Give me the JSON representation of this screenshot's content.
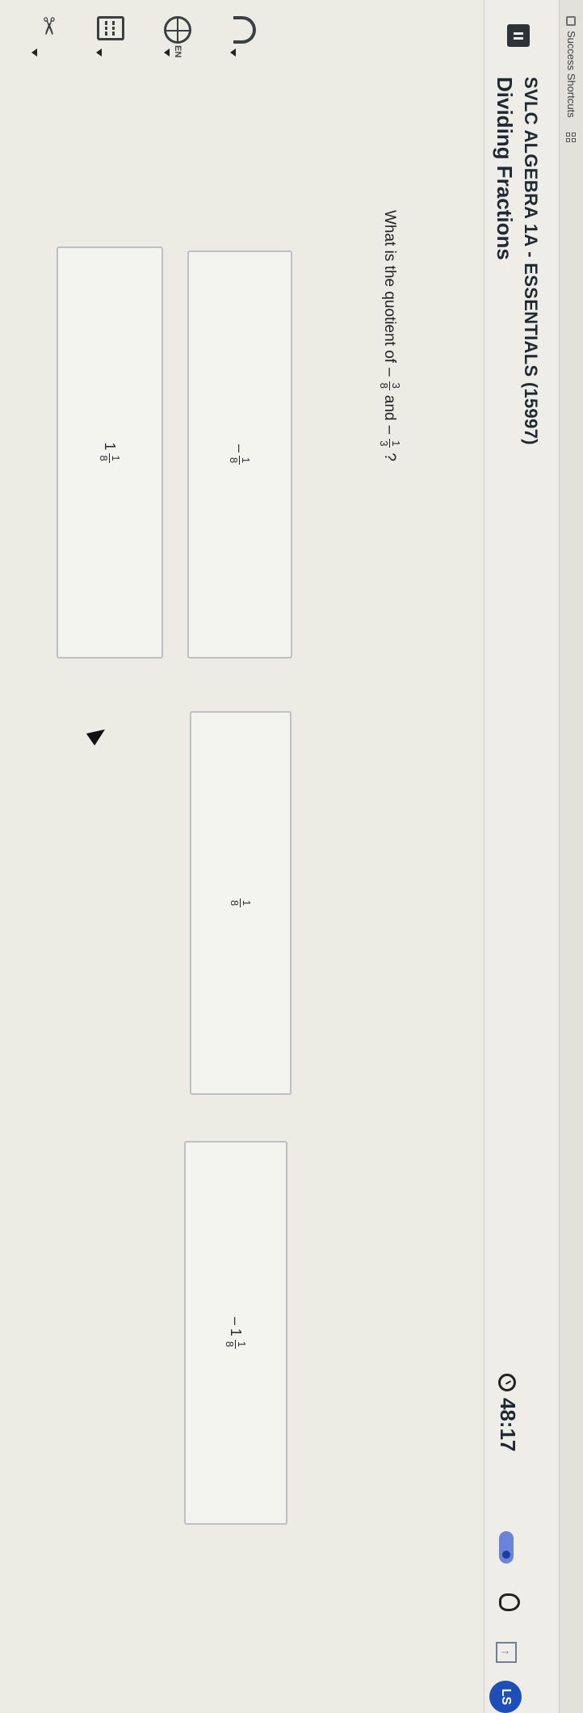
{
  "bookmarks": {
    "items": [
      {
        "label": "Success Shortcuts",
        "icon": "bookmark-icon"
      }
    ],
    "apps_icon": "apps-grid-icon"
  },
  "header": {
    "course_title": "SVLC ALGEBRA 1A - ESSENTIALS (15997)",
    "lesson_title": "Dividing Fractions",
    "timer": "48:17",
    "avatar_initials": "LS"
  },
  "tools": {
    "language": "EN"
  },
  "question": {
    "prefix": "What is the quotient of",
    "a_sign": "–",
    "a_num": "3",
    "a_den": "8",
    "conj": "and",
    "b_sign": "–",
    "b_num": "1",
    "b_den": "3",
    "suffix": "?"
  },
  "choices": [
    {
      "sign": "–",
      "whole": "",
      "num": "1",
      "den": "8"
    },
    {
      "sign": "",
      "whole": "",
      "num": "1",
      "den": "8"
    },
    {
      "sign": "–",
      "whole": "1",
      "num": "1",
      "den": "8"
    },
    {
      "sign": "",
      "whole": "1",
      "num": "1",
      "den": "8"
    }
  ],
  "colors": {
    "accent": "#1e4fb8",
    "toggle": "#6b84d8"
  }
}
